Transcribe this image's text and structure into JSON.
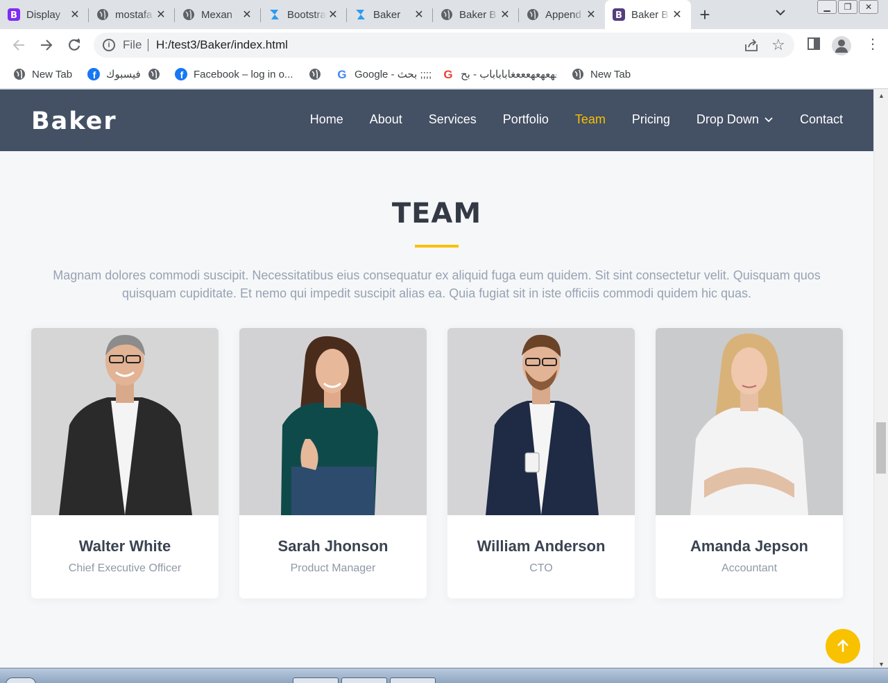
{
  "browser": {
    "tabs": [
      {
        "title": "Display",
        "icon": "bootstrap-icon",
        "active": false
      },
      {
        "title": "mostafa",
        "icon": "globe-icon",
        "active": false
      },
      {
        "title": "Mexan",
        "icon": "globe-icon",
        "active": false
      },
      {
        "title": "Bootstrap",
        "icon": "bootstrapmade-icon",
        "active": false
      },
      {
        "title": "Baker",
        "icon": "bootstrapmade-icon",
        "active": false
      },
      {
        "title": "Baker B",
        "icon": "globe-icon",
        "active": false
      },
      {
        "title": "Append",
        "icon": "globe-icon",
        "active": false
      },
      {
        "title": "Baker B",
        "icon": "bootstrap-icon",
        "active": true
      }
    ],
    "address": {
      "scheme_label": "File",
      "url": "H:/test3/Baker/index.html"
    },
    "bookmarks": [
      {
        "label": "New Tab",
        "icon": "globe-icon"
      },
      {
        "label": "فيسبوك",
        "icon": "facebook-icon"
      },
      {
        "label": "",
        "icon": "globe-icon"
      },
      {
        "label": "Facebook – log in o...",
        "icon": "facebook-icon"
      },
      {
        "label": "",
        "icon": "globe-icon"
      },
      {
        "label": "Google - بحث ;;;;",
        "icon": "google-icon"
      },
      {
        "label": "هعهعهعهعععغاباباباب - بح...",
        "icon": "google-icon"
      },
      {
        "label": "New Tab",
        "icon": "globe-icon"
      }
    ]
  },
  "site": {
    "logo": "Baker",
    "nav": [
      {
        "label": "Home",
        "active": false
      },
      {
        "label": "About",
        "active": false
      },
      {
        "label": "Services",
        "active": false
      },
      {
        "label": "Portfolio",
        "active": false
      },
      {
        "label": "Team",
        "active": true
      },
      {
        "label": "Pricing",
        "active": false
      },
      {
        "label": "Drop Down",
        "active": false,
        "dropdown": true
      },
      {
        "label": "Contact",
        "active": false
      }
    ],
    "accent_color": "#f8c200",
    "header_color": "#445064"
  },
  "team": {
    "title": "TEAM",
    "description": "Magnam dolores commodi suscipit. Necessitatibus eius consequatur ex aliquid fuga eum quidem. Sit sint consectetur velit. Quisquam quos quisquam cupiditate. Et nemo qui impedit suscipit alias ea. Quia fugiat sit in iste officiis commodi quidem hic quas.",
    "members": [
      {
        "name": "Walter White",
        "role": "Chief Executive Officer"
      },
      {
        "name": "Sarah Jhonson",
        "role": "Product Manager"
      },
      {
        "name": "William Anderson",
        "role": "CTO"
      },
      {
        "name": "Amanda Jepson",
        "role": "Accountant"
      }
    ]
  }
}
